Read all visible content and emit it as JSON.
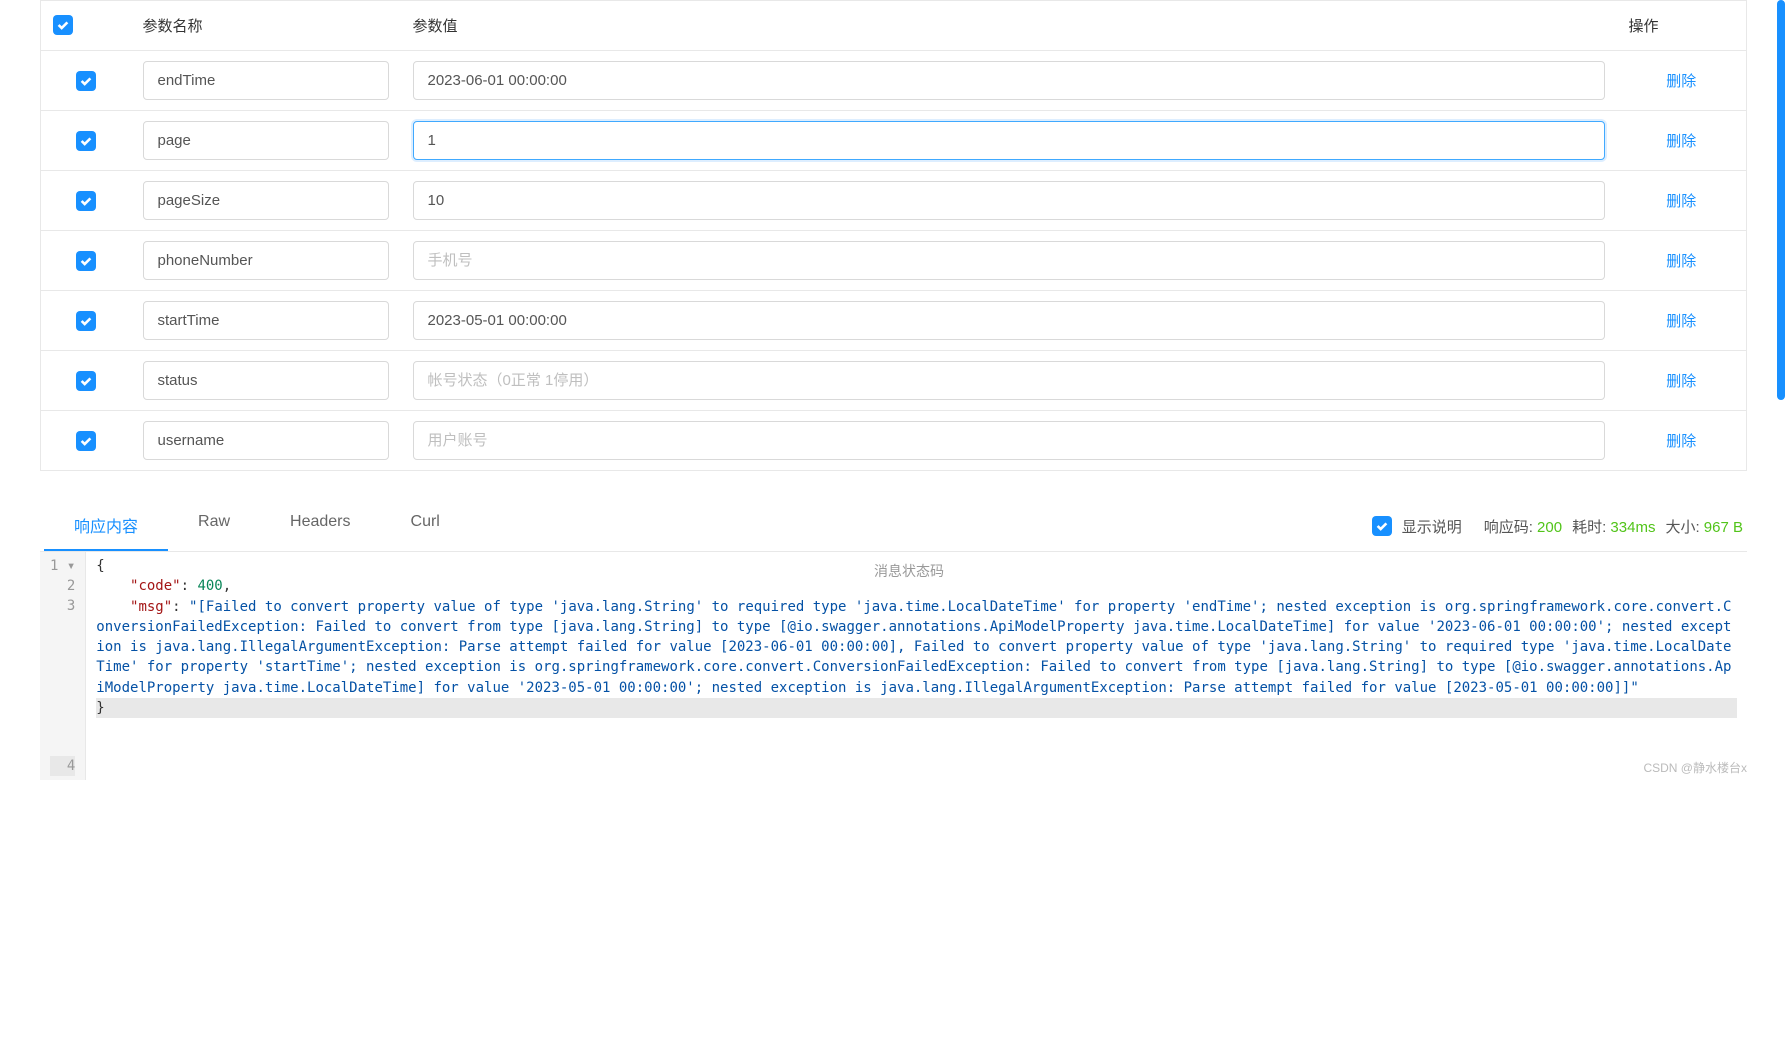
{
  "table": {
    "headers": {
      "name": "参数名称",
      "value": "参数值",
      "action": "操作"
    },
    "delete_label": "删除",
    "rows": [
      {
        "checked": true,
        "name": "endTime",
        "value": "2023-06-01 00:00:00",
        "placeholder": ""
      },
      {
        "checked": true,
        "name": "page",
        "value": "1",
        "placeholder": "",
        "focused": true
      },
      {
        "checked": true,
        "name": "pageSize",
        "value": "10",
        "placeholder": ""
      },
      {
        "checked": true,
        "name": "phoneNumber",
        "value": "",
        "placeholder": "手机号"
      },
      {
        "checked": true,
        "name": "startTime",
        "value": "2023-05-01 00:00:00",
        "placeholder": ""
      },
      {
        "checked": true,
        "name": "status",
        "value": "",
        "placeholder": "帐号状态（0正常 1停用）"
      },
      {
        "checked": true,
        "name": "username",
        "value": "",
        "placeholder": "用户账号"
      }
    ]
  },
  "response": {
    "tabs": [
      {
        "id": "content",
        "label": "响应内容",
        "active": true
      },
      {
        "id": "raw",
        "label": "Raw",
        "active": false
      },
      {
        "id": "headers",
        "label": "Headers",
        "active": false
      },
      {
        "id": "curl",
        "label": "Curl",
        "active": false
      }
    ],
    "show_desc_checked": true,
    "show_desc_label": "显示说明",
    "code_label": "响应码:",
    "code_value": "200",
    "time_label": "耗时:",
    "time_value": "334ms",
    "size_label": "大小:",
    "size_value": "967 B",
    "tooltip": "消息状态码",
    "json_body": {
      "line1_open": "{",
      "line2_key": "\"code\"",
      "line2_colon": ": ",
      "line2_val": "400",
      "line2_comma": ",",
      "line3_key": "\"msg\"",
      "line3_colon": ": ",
      "line3_val": "\"[Failed to convert property value of type 'java.lang.String' to required type 'java.time.LocalDateTime' for property 'endTime'; nested exception is org.springframework.core.convert.ConversionFailedException: Failed to convert from type [java.lang.String] to type [@io.swagger.annotations.ApiModelProperty java.time.LocalDateTime] for value '2023-06-01 00:00:00'; nested exception is java.lang.IllegalArgumentException: Parse attempt failed for value [2023-06-01 00:00:00], Failed to convert property value of type 'java.lang.String' to required type 'java.time.LocalDateTime' for property 'startTime'; nested exception is org.springframework.core.convert.ConversionFailedException: Failed to convert from type [java.lang.String] to type [@io.swagger.annotations.ApiModelProperty java.time.LocalDateTime] for value '2023-05-01 00:00:00'; nested exception is java.lang.IllegalArgumentException: Parse attempt failed for value [2023-05-01 00:00:00]]\"",
      "line4_close": "}"
    },
    "gutter": [
      "1 ▾",
      "2",
      "3",
      "4"
    ]
  },
  "watermark": "CSDN @静水楼台x"
}
